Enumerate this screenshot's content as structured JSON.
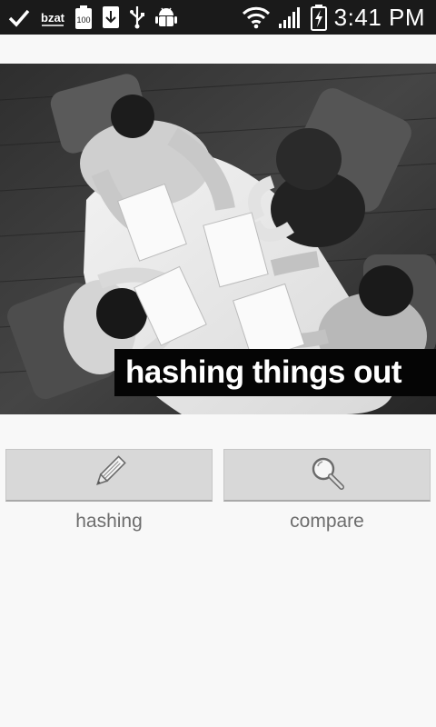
{
  "status_bar": {
    "time": "3:41 PM",
    "left_icons": [
      "check-icon",
      "bzat-icon",
      "battery-100-icon",
      "download-icon",
      "usb-icon",
      "android-debug-icon"
    ],
    "right_icons": [
      "wifi-icon",
      "signal-icon",
      "battery-charging-icon"
    ],
    "bzat_text": "bzat",
    "battery_text": "100"
  },
  "banner": {
    "caption": "hashing things out"
  },
  "actions": {
    "hashing": {
      "label": "hashing",
      "icon": "pencil-icon"
    },
    "compare": {
      "label": "compare",
      "icon": "magnifier-icon"
    }
  }
}
